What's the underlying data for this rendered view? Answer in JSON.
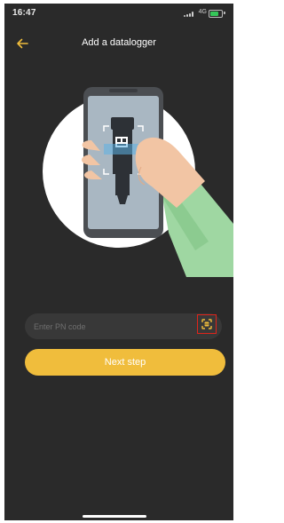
{
  "status_bar": {
    "time": "16:47",
    "network": "4G"
  },
  "header": {
    "title": "Add a datalogger",
    "back_icon": "arrow-left-icon"
  },
  "form": {
    "pn_placeholder": "Enter PN code",
    "pn_value": "",
    "scan_icon": "scan-icon"
  },
  "actions": {
    "next_label": "Next step"
  },
  "colors": {
    "background": "#2a2a2a",
    "accent": "#f0bd3c",
    "input_bg": "#383838",
    "highlight": "#e0241a"
  }
}
